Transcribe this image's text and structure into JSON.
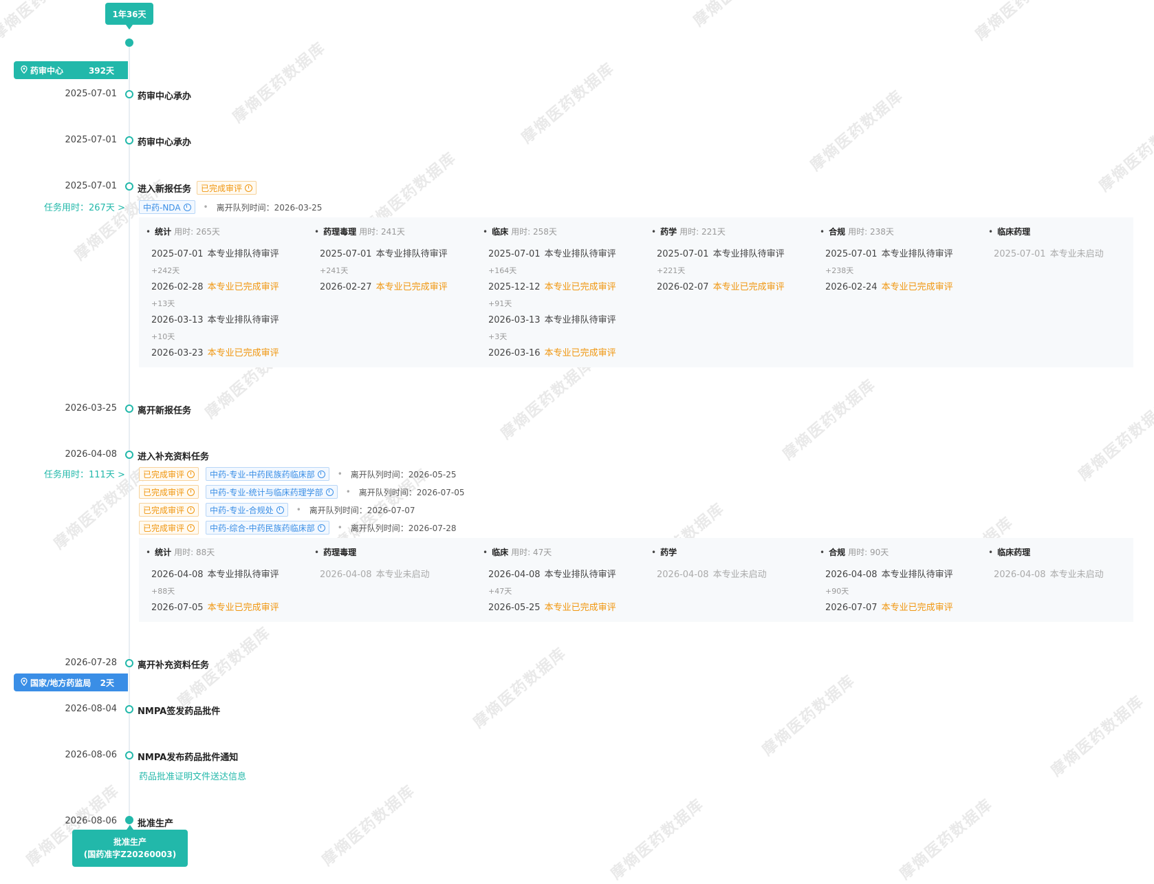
{
  "top_badge": "1年36天",
  "stages": {
    "drug_center": {
      "label": "药审中心",
      "days": "392天",
      "color": "#22b8aa"
    },
    "nmpa": {
      "label": "国家/地方药监局",
      "days": "2天",
      "color": "#3a8ee6"
    }
  },
  "events": {
    "e1": {
      "date": "2025-07-01",
      "title": "药审中心承办"
    },
    "e2": {
      "date": "2025-07-01",
      "title": "药审中心承办"
    },
    "e3": {
      "date": "2025-07-01",
      "title": "进入新报任务",
      "status": "已完成审评"
    },
    "e4": {
      "date": "2026-03-25",
      "title": "离开新报任务"
    },
    "e5": {
      "date": "2026-04-08",
      "title": "进入补充资料任务"
    },
    "e6": {
      "date": "2026-07-28",
      "title": "离开补充资料任务"
    },
    "e7": {
      "date": "2026-08-04",
      "title": "NMPA签发药品批件"
    },
    "e8": {
      "date": "2026-08-06",
      "title": "NMPA发布药品批件通知",
      "link": "药品批准证明文件送达信息"
    },
    "e9": {
      "date": "2026-08-06",
      "title": "批准生产"
    }
  },
  "task1": {
    "time": "任务用时：267天 >",
    "queue_tag": "中药-NDA",
    "leave_text": "离开队列时间：2026-03-25",
    "columns": [
      {
        "name": "统计",
        "used": "用时: 265天",
        "rows": [
          {
            "date": "2025-07-01",
            "status": "本专业排队待审评",
            "kind": "queue"
          },
          {
            "gap": "+242天"
          },
          {
            "date": "2026-02-28",
            "status": "本专业已完成审评",
            "kind": "done"
          },
          {
            "gap": "+13天"
          },
          {
            "date": "2026-03-13",
            "status": "本专业排队待审评",
            "kind": "queue"
          },
          {
            "gap": "+10天"
          },
          {
            "date": "2026-03-23",
            "status": "本专业已完成审评",
            "kind": "done"
          }
        ]
      },
      {
        "name": "药理毒理",
        "used": "用时: 241天",
        "rows": [
          {
            "date": "2025-07-01",
            "status": "本专业排队待审评",
            "kind": "queue"
          },
          {
            "gap": "+241天"
          },
          {
            "date": "2026-02-27",
            "status": "本专业已完成审评",
            "kind": "done"
          }
        ]
      },
      {
        "name": "临床",
        "used": "用时: 258天",
        "rows": [
          {
            "date": "2025-07-01",
            "status": "本专业排队待审评",
            "kind": "queue"
          },
          {
            "gap": "+164天"
          },
          {
            "date": "2025-12-12",
            "status": "本专业已完成审评",
            "kind": "done"
          },
          {
            "gap": "+91天"
          },
          {
            "date": "2026-03-13",
            "status": "本专业排队待审评",
            "kind": "queue"
          },
          {
            "gap": "+3天"
          },
          {
            "date": "2026-03-16",
            "status": "本专业已完成审评",
            "kind": "done"
          }
        ]
      },
      {
        "name": "药学",
        "used": "用时: 221天",
        "rows": [
          {
            "date": "2025-07-01",
            "status": "本专业排队待审评",
            "kind": "queue"
          },
          {
            "gap": "+221天"
          },
          {
            "date": "2026-02-07",
            "status": "本专业已完成审评",
            "kind": "done"
          }
        ]
      },
      {
        "name": "合规",
        "used": "用时: 238天",
        "rows": [
          {
            "date": "2025-07-01",
            "status": "本专业排队待审评",
            "kind": "queue"
          },
          {
            "gap": "+238天"
          },
          {
            "date": "2026-02-24",
            "status": "本专业已完成审评",
            "kind": "done"
          }
        ]
      },
      {
        "name": "临床药理",
        "used": "",
        "rows": [
          {
            "date": "2025-07-01",
            "status": "本专业未启动",
            "kind": "gray"
          }
        ]
      }
    ]
  },
  "task2": {
    "time": "任务用时：111天 >",
    "queues": [
      {
        "status": "已完成审评",
        "tag": "中药-专业-中药民族药临床部",
        "leave_text": "离开队列时间：2026-05-25"
      },
      {
        "status": "已完成审评",
        "tag": "中药-专业-统计与临床药理学部",
        "leave_text": "离开队列时间：2026-07-05"
      },
      {
        "status": "已完成审评",
        "tag": "中药-专业-合规处",
        "leave_text": "离开队列时间：2026-07-07"
      },
      {
        "status": "已完成审评",
        "tag": "中药-综合-中药民族药临床部",
        "leave_text": "离开队列时间：2026-07-28"
      }
    ],
    "columns": [
      {
        "name": "统计",
        "used": "用时: 88天",
        "rows": [
          {
            "date": "2026-04-08",
            "status": "本专业排队待审评",
            "kind": "queue"
          },
          {
            "gap": "+88天"
          },
          {
            "date": "2026-07-05",
            "status": "本专业已完成审评",
            "kind": "done"
          }
        ]
      },
      {
        "name": "药理毒理",
        "used": "",
        "rows": [
          {
            "date": "2026-04-08",
            "status": "本专业未启动",
            "kind": "gray"
          }
        ]
      },
      {
        "name": "临床",
        "used": "用时: 47天",
        "rows": [
          {
            "date": "2026-04-08",
            "status": "本专业排队待审评",
            "kind": "queue"
          },
          {
            "gap": "+47天"
          },
          {
            "date": "2026-05-25",
            "status": "本专业已完成审评",
            "kind": "done"
          }
        ]
      },
      {
        "name": "药学",
        "used": "",
        "rows": [
          {
            "date": "2026-04-08",
            "status": "本专业未启动",
            "kind": "gray"
          }
        ]
      },
      {
        "name": "合规",
        "used": "用时: 90天",
        "rows": [
          {
            "date": "2026-04-08",
            "status": "本专业排队待审评",
            "kind": "queue"
          },
          {
            "gap": "+90天"
          },
          {
            "date": "2026-07-07",
            "status": "本专业已完成审评",
            "kind": "done"
          }
        ]
      },
      {
        "name": "临床药理",
        "used": "",
        "rows": [
          {
            "date": "2026-04-08",
            "status": "本专业未启动",
            "kind": "gray"
          }
        ]
      }
    ]
  },
  "final_badge": {
    "line1": "批准生产",
    "line2": "(国药准字Z20260003)"
  },
  "watermark": "摩熵医药数据库"
}
